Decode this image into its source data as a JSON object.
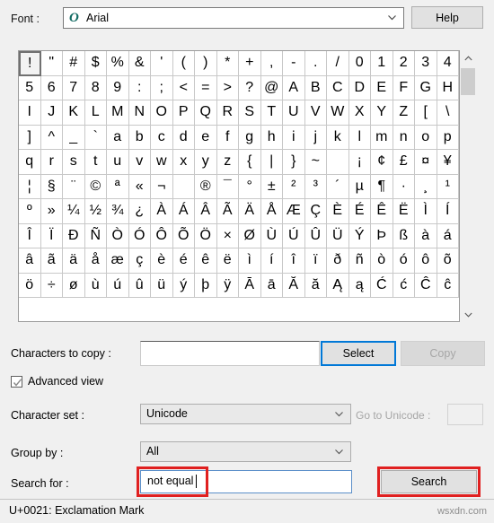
{
  "font_row": {
    "label": "Font :",
    "selected_font": "Arial",
    "font_icon": "opentype-o-icon",
    "help_label": "Help"
  },
  "grid": {
    "columns": 20,
    "selected_index": 0,
    "characters": [
      "!",
      "\"",
      "#",
      "$",
      "%",
      "&",
      "'",
      "(",
      ")",
      "*",
      "+",
      ",",
      "-",
      ".",
      "/",
      "0",
      "1",
      "2",
      "3",
      "4",
      "5",
      "6",
      "7",
      "8",
      "9",
      ":",
      ";",
      "<",
      "=",
      ">",
      "?",
      "@",
      "A",
      "B",
      "C",
      "D",
      "E",
      "F",
      "G",
      "H",
      "I",
      "J",
      "K",
      "L",
      "M",
      "N",
      "O",
      "P",
      "Q",
      "R",
      "S",
      "T",
      "U",
      "V",
      "W",
      "X",
      "Y",
      "Z",
      "[",
      "\\",
      "]",
      "^",
      "_",
      "`",
      "a",
      "b",
      "c",
      "d",
      "e",
      "f",
      "g",
      "h",
      "i",
      "j",
      "k",
      "l",
      "m",
      "n",
      "o",
      "p",
      "q",
      "r",
      "s",
      "t",
      "u",
      "v",
      "w",
      "x",
      "y",
      "z",
      "{",
      "|",
      "}",
      "~",
      " ",
      "¡",
      "¢",
      "£",
      "¤",
      "¥",
      "¦",
      "§",
      "¨",
      "©",
      "ª",
      "«",
      "¬",
      "­",
      "®",
      "¯",
      "°",
      "±",
      "²",
      "³",
      "´",
      "µ",
      "¶",
      "·",
      "¸",
      "¹",
      "º",
      "»",
      "¼",
      "½",
      "¾",
      "¿",
      "À",
      "Á",
      "Â",
      "Ã",
      "Ä",
      "Å",
      "Æ",
      "Ç",
      "È",
      "É",
      "Ê",
      "Ë",
      "Ì",
      "Í",
      "Î",
      "Ï",
      "Ð",
      "Ñ",
      "Ò",
      "Ó",
      "Ô",
      "Õ",
      "Ö",
      "×",
      "Ø",
      "Ù",
      "Ú",
      "Û",
      "Ü",
      "Ý",
      "Þ",
      "ß",
      "à",
      "á",
      "â",
      "ã",
      "ä",
      "å",
      "æ",
      "ç",
      "è",
      "é",
      "ê",
      "ë",
      "ì",
      "í",
      "î",
      "ï",
      "ð",
      "ñ",
      "ò",
      "ó",
      "ô",
      "õ",
      "ö",
      "÷",
      "ø",
      "ù",
      "ú",
      "û",
      "ü",
      "ý",
      "þ",
      "ÿ",
      "Ā",
      "ā",
      "Ă",
      "ă",
      "Ą",
      "ą",
      "Ć",
      "ć",
      "Ĉ",
      "ĉ"
    ]
  },
  "scrollbar": {
    "up_icon": "chevron-up-icon",
    "down_icon": "chevron-down-icon"
  },
  "copy_row": {
    "label": "Characters to copy :",
    "input_value": "",
    "select_label": "Select",
    "copy_label": "Copy",
    "copy_disabled": true
  },
  "advanced": {
    "label": "Advanced view",
    "checked": true
  },
  "character_set": {
    "label": "Character set :",
    "value": "Unicode"
  },
  "go_to_unicode": {
    "label": "Go to Unicode :",
    "value": "",
    "disabled": true
  },
  "group_by": {
    "label": "Group by :",
    "value": "All"
  },
  "search": {
    "label": "Search for :",
    "value": "not equal",
    "button_label": "Search"
  },
  "status": {
    "text": "U+0021: Exclamation Mark",
    "watermark": "wsxdn.com"
  },
  "colors": {
    "window_bg": "#f0f0f0",
    "accent_focus": "#0078d7",
    "annotation_red": "#e02020",
    "opentype_icon": "#126b63"
  }
}
